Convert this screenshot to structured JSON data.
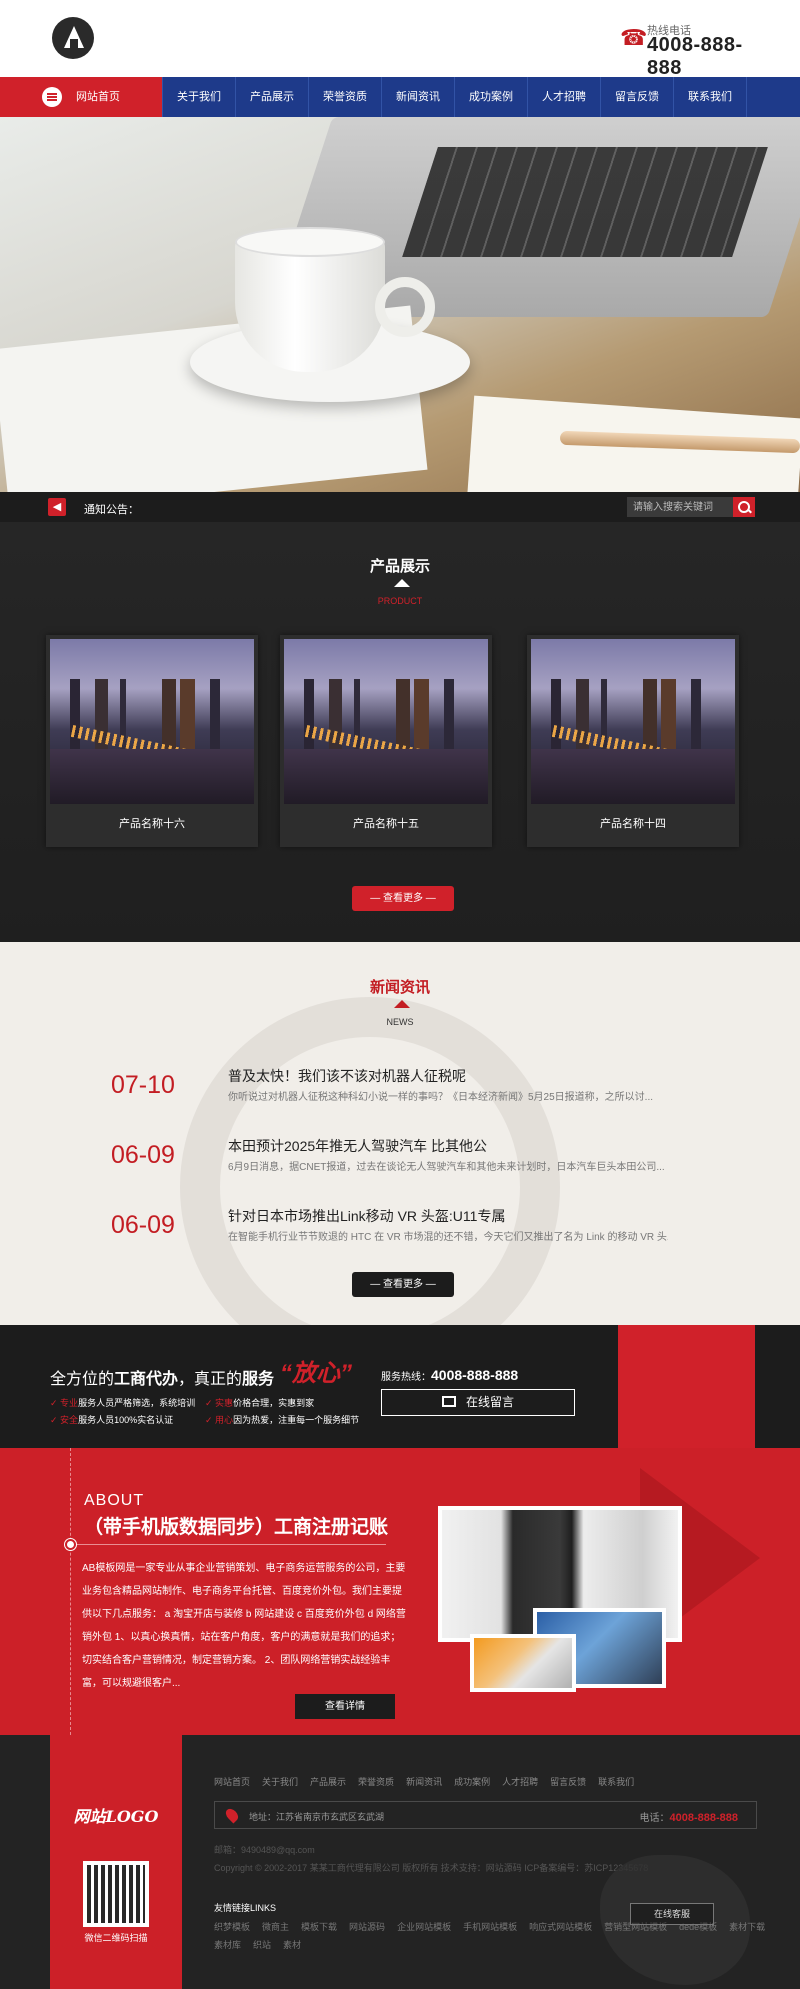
{
  "header": {
    "hotline_label": "热线电话",
    "hotline_number": "4008-888-888"
  },
  "nav": {
    "items": [
      {
        "label": "网站首页"
      },
      {
        "label": "关于我们"
      },
      {
        "label": "产品展示"
      },
      {
        "label": "荣誉资质"
      },
      {
        "label": "新闻资讯"
      },
      {
        "label": "成功案例"
      },
      {
        "label": "人才招聘"
      },
      {
        "label": "留言反馈"
      },
      {
        "label": "联系我们"
      }
    ]
  },
  "banner": {
    "dots": 3,
    "active_dot": 2
  },
  "notice": {
    "label": "通知公告：",
    "search_placeholder": "请输入搜索关键词"
  },
  "products": {
    "title": "产品展示",
    "subtitle": "PRODUCT",
    "items": [
      {
        "name": "产品名称十六"
      },
      {
        "name": "产品名称十五"
      },
      {
        "name": "产品名称十四"
      }
    ],
    "more_label": "— 查看更多 —"
  },
  "news": {
    "title": "新闻资讯",
    "subtitle": "NEWS",
    "items": [
      {
        "date": "07-10",
        "title": "普及太快！我们该不该对机器人征税呢",
        "desc": "你听说过对机器人征税这种科幻小说一样的事吗？《日本经济新闻》5月25日报道称，之所以讨..."
      },
      {
        "date": "06-09",
        "title": "本田预计2025年推无人驾驶汽车 比其他公",
        "desc": "6月9日消息，据CNET报道，过去在谈论无人驾驶汽车和其他未来计划时，日本汽车巨头本田公司..."
      },
      {
        "date": "06-09",
        "title": "针对日本市场推出Link移动 VR 头盔:U11专属",
        "desc": "在智能手机行业节节败退的 HTC 在 VR 市场混的还不错，今天它们又推出了名为 Link 的移动 VR 头..."
      }
    ],
    "more_label": "— 查看更多 —"
  },
  "cta": {
    "title_plain_1": "全方位的",
    "title_bold_1": "工商代办",
    "title_plain_2": "，真正的",
    "title_bold_2": "服务",
    "quote": "“放心”",
    "bullets": [
      {
        "hl": "专业",
        "text": "服务人员严格筛选，系统培训"
      },
      {
        "hl": "实惠",
        "text": "价格合理，实惠到家"
      },
      {
        "hl": "安全",
        "text": "服务人员100%实名认证"
      },
      {
        "hl": "用心",
        "text": "因为热爱，注重每一个服务细节"
      }
    ],
    "hotline_label": "服务热线：",
    "hotline_number": "4008-888-888",
    "message_button": "在线留言"
  },
  "about": {
    "en": "ABOUT",
    "title": "（带手机版数据同步）工商注册记账",
    "text": "AB模板网是一家专业从事企业营销策划、电子商务运营服务的公司，主要业务包含精品网站制作、电子商务平台托管、百度竞价外包。我们主要提供以下几点服务： a 淘宝开店与装修 b 网站建设 c 百度竞价外包 d 网络营销外包 1、以真心换真情，站在客户角度，客户的满意就是我们的追求；切实结合客户营销情况，制定营销方案。 2、团队网络营销实战经验丰富，可以规避很客户...",
    "button": "查看详情"
  },
  "footer": {
    "logo_text": "网站LOGO",
    "qr_caption": "微信二维码扫描",
    "nav": [
      "网站首页",
      "关于我们",
      "产品展示",
      "荣誉资质",
      "新闻资讯",
      "成功案例",
      "人才招聘",
      "留言反馈",
      "联系我们"
    ],
    "address": "地址：江苏省南京市玄武区玄武湖",
    "tel_label": "电话：",
    "tel_number": "4008-888-888",
    "email": "邮箱：9490489@qq.com",
    "copyright": "Copyright © 2002-2017 某某工商代理有限公司 版权所有     技术支持：网站源码     ICP备案编号：苏ICP12345678",
    "links_title": "友情链接LINKS",
    "links_row1": [
      "织梦模板",
      "微商主",
      "模板下载",
      "网站源码",
      "企业网站模板",
      "手机网站模板",
      "响应式网站模板",
      "营销型网站模板",
      "dede模板",
      "素材下载"
    ],
    "links_row2": [
      "素材库",
      "织站",
      "素材"
    ],
    "service_button": "在线客服"
  }
}
